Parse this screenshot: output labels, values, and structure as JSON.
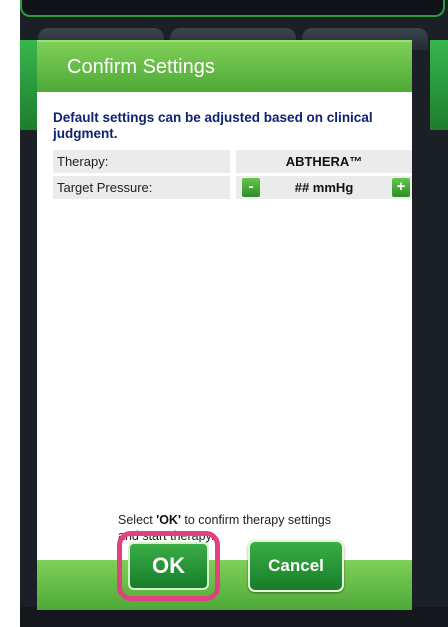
{
  "dialog": {
    "title": "Confirm Settings",
    "intro": "Default settings can be adjusted based on clinical judgment.",
    "rows": [
      {
        "label": "Therapy:",
        "value": "ABTHERA™"
      },
      {
        "label": "Target Pressure:",
        "value": "## mmHg",
        "minus": "-",
        "plus": "+"
      }
    ],
    "instruction_prefix": "Select ",
    "instruction_key": "'OK'",
    "instruction_line1_rest": " to confirm therapy settings",
    "instruction_line2": "and start therapy.",
    "buttons": {
      "ok": "OK",
      "cancel": "Cancel"
    }
  },
  "colors": {
    "header_green": "#5fb845",
    "button_green": "#239a33",
    "highlight_pink": "#e0417f",
    "intro_text": "#0f2370"
  }
}
